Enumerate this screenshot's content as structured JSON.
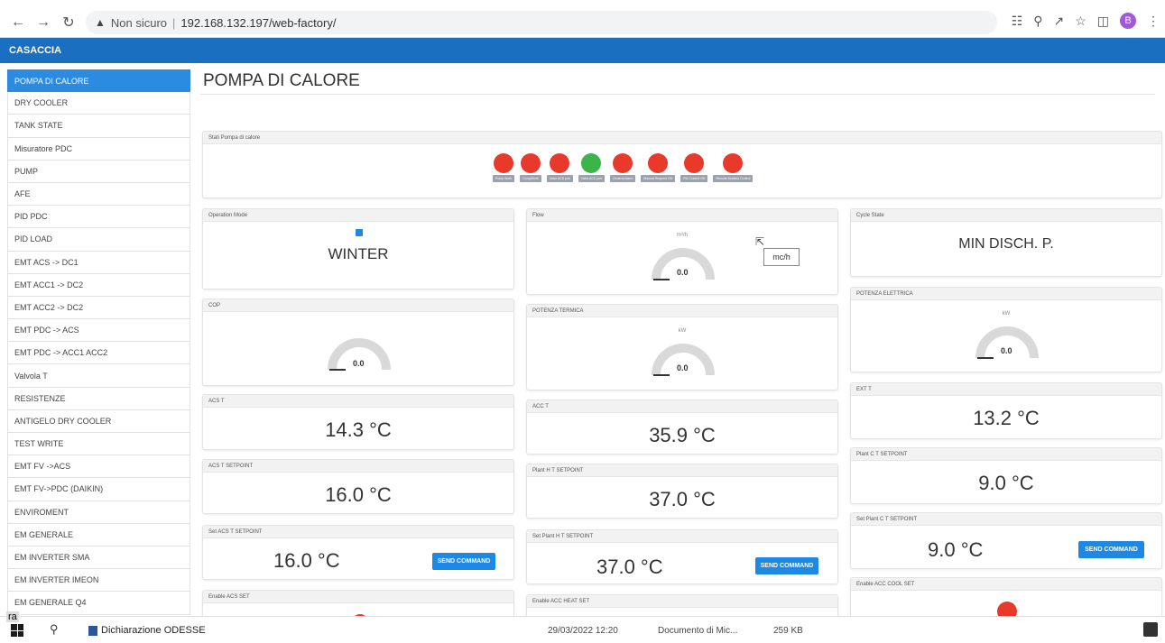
{
  "browser": {
    "security_text": "Non sicuro",
    "url": "192.168.132.197/web-factory/",
    "profile_initial": "B"
  },
  "app": {
    "title": "CASACCIA"
  },
  "sidebar": {
    "items": [
      {
        "label": "POMPA DI CALORE",
        "active": true
      },
      {
        "label": "DRY COOLER"
      },
      {
        "label": "TANK STATE"
      },
      {
        "label": "Misuratore PDC"
      },
      {
        "label": "PUMP"
      },
      {
        "label": "AFE"
      },
      {
        "label": "PID PDC"
      },
      {
        "label": "PID LOAD"
      },
      {
        "label": "EMT ACS -> DC1"
      },
      {
        "label": "EMT ACC1 -> DC2"
      },
      {
        "label": "EMT ACC2 -> DC2"
      },
      {
        "label": "EMT PDC -> ACS"
      },
      {
        "label": "EMT PDC -> ACC1 ACC2"
      },
      {
        "label": "Valvola T"
      },
      {
        "label": "RESISTENZE"
      },
      {
        "label": "ANTIGELO DRY COOLER"
      },
      {
        "label": "TEST WRITE"
      },
      {
        "label": "EMT FV ->ACS"
      },
      {
        "label": "EMT FV->PDC (DAIKIN)"
      },
      {
        "label": "ENVIROMENT"
      },
      {
        "label": "EM GENERALE"
      },
      {
        "label": "EM INVERTER SMA"
      },
      {
        "label": "EM INVERTER IMEON"
      },
      {
        "label": "EM GENERALE Q4"
      }
    ]
  },
  "page": {
    "title": "POMPA DI CALORE"
  },
  "states": {
    "title": "Stati Pompa di calore",
    "leds": [
      {
        "label": "Pump Work",
        "on": false
      },
      {
        "label": "CompWork",
        "on": false
      },
      {
        "label": "Valve ACS pos",
        "on": false
      },
      {
        "label": "Valve ACC pos",
        "on": true
      },
      {
        "label": "General Alarm",
        "on": false
      },
      {
        "label": "Manual Request ON",
        "on": false
      },
      {
        "label": "PID Control ON",
        "on": false
      },
      {
        "label": "Remote Modbus Control",
        "on": false
      }
    ]
  },
  "cards": {
    "operation_mode": {
      "title": "Operation Mode",
      "value": "WINTER"
    },
    "flow": {
      "title": "Flow",
      "unit": "m³/h",
      "value": "0.0",
      "tooltip": "mc/h"
    },
    "cycle_state": {
      "title": "Cycle State",
      "value": "MIN DISCH. P."
    },
    "cop": {
      "title": "COP",
      "value": "0.0"
    },
    "potenza_termica": {
      "title": "POTENZA TERMICA",
      "unit": "kW",
      "value": "0.0"
    },
    "potenza_elettrica": {
      "title": "POTENZA ELETTRICA",
      "unit": "kW",
      "value": "0.0"
    },
    "acs_t": {
      "title": "ACS T",
      "value": "14.3 °C"
    },
    "acc_t": {
      "title": "ACC T",
      "value": "35.9 °C"
    },
    "ext_t": {
      "title": "EXT T",
      "value": "13.2 °C"
    },
    "acs_t_setpoint": {
      "title": "ACS T SETPOINT",
      "value": "16.0 °C"
    },
    "plant_h_t_setpoint": {
      "title": "Plant H T SETPOINT",
      "value": "37.0 °C"
    },
    "plant_c_t_setpoint": {
      "title": "Plant C T SETPOINT",
      "value": "9.0 °C"
    },
    "set_acs_t_setpoint": {
      "title": "Set ACS T SETPOINT",
      "value": "16.0 °C",
      "button": "SEND COMMAND"
    },
    "set_plant_h_t_setpoint": {
      "title": "Set Plant H T SETPOINT",
      "value": "37.0 °C",
      "button": "SEND COMMAND"
    },
    "set_plant_c_t_setpoint": {
      "title": "Set Plant C T SETPOINT",
      "value": "9.0 °C",
      "button": "SEND COMMAND"
    },
    "enable_acs_set": {
      "title": "Enable ACS SET"
    },
    "enable_acc_heat_set": {
      "title": "Enable ACC HEAT SET"
    },
    "enable_acc_cool_set": {
      "title": "Enable ACC COOL SET"
    }
  },
  "taskbar": {
    "doc_name": "Dichiarazione ODESSE",
    "doc_date": "29/03/2022 12:20",
    "doc_type": "Documento di Mic...",
    "doc_size": "259 KB",
    "overlay_tag": "ra"
  },
  "colors": {
    "accent": "#1a6fc0",
    "active_item": "#2a8be0",
    "led_off": "#e8392b",
    "led_on": "#3bb54a",
    "button": "#1e88e5"
  }
}
